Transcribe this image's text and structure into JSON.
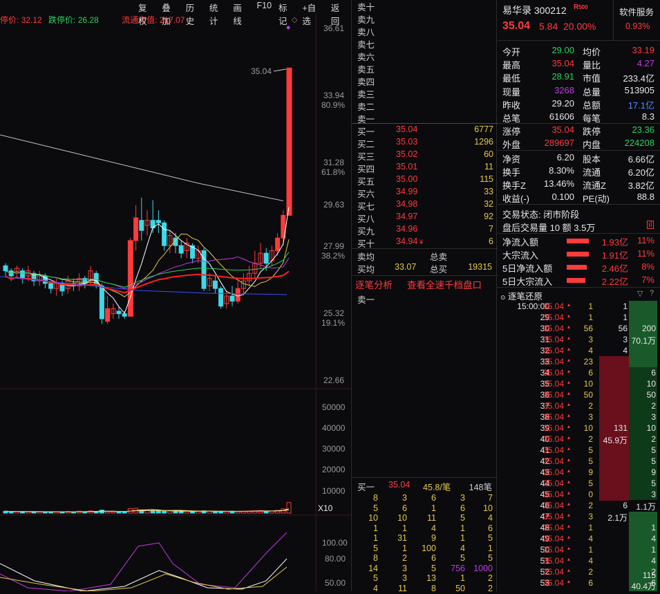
{
  "chart_header": {
    "limit_up": "停价: 32.12",
    "limit_down": "跌停价: 26.28",
    "float_cap": "流通市值: 217.07"
  },
  "toolbar": [
    "复权",
    "叠加",
    "历史",
    "统计",
    "画线",
    "F10",
    "标记",
    "+自选",
    "返回"
  ],
  "price_axis": [
    {
      "price": "36.61",
      "pct": ""
    },
    {
      "price": "33.94",
      "pct": "80.9%"
    },
    {
      "price": "31.28",
      "pct": "61.8%"
    },
    {
      "price": "29.63",
      "pct": ""
    },
    {
      "price": "27.99",
      "pct": "38.2%"
    },
    {
      "price": "25.32",
      "pct": "19.1%"
    },
    {
      "price": "22.66",
      "pct": ""
    }
  ],
  "high_marker": "35.04",
  "volume_axis": [
    "50000",
    "40000",
    "30000",
    "20000",
    "10000"
  ],
  "volume_unit": "X10",
  "indicator_axis": [
    "100.00",
    "80.00",
    "50.00"
  ],
  "candles": [
    {
      "o": 27.2,
      "c": 27.0,
      "h": 27.3,
      "l": 26.8
    },
    {
      "o": 27.0,
      "c": 26.8,
      "h": 27.1,
      "l": 26.6
    },
    {
      "o": 26.9,
      "c": 27.1,
      "h": 27.2,
      "l": 26.7
    },
    {
      "o": 27.0,
      "c": 26.7,
      "h": 27.1,
      "l": 26.5
    },
    {
      "o": 26.8,
      "c": 27.0,
      "h": 27.2,
      "l": 26.6
    },
    {
      "o": 26.9,
      "c": 26.6,
      "h": 27.0,
      "l": 26.4
    },
    {
      "o": 26.6,
      "c": 26.8,
      "h": 27.0,
      "l": 26.4
    },
    {
      "o": 26.8,
      "c": 26.5,
      "h": 26.9,
      "l": 26.3
    },
    {
      "o": 26.5,
      "c": 26.3,
      "h": 26.6,
      "l": 26.1
    },
    {
      "o": 26.3,
      "c": 26.5,
      "h": 26.7,
      "l": 26.0
    },
    {
      "o": 26.5,
      "c": 26.2,
      "h": 26.6,
      "l": 26.0
    },
    {
      "o": 26.3,
      "c": 26.6,
      "h": 26.8,
      "l": 26.1
    },
    {
      "o": 26.5,
      "c": 26.4,
      "h": 26.7,
      "l": 26.2
    },
    {
      "o": 26.4,
      "c": 26.7,
      "h": 26.9,
      "l": 26.2
    },
    {
      "o": 26.7,
      "c": 26.5,
      "h": 26.8,
      "l": 26.3
    },
    {
      "o": 26.6,
      "c": 27.0,
      "h": 27.2,
      "l": 26.4
    },
    {
      "o": 26.9,
      "c": 26.5,
      "h": 27.0,
      "l": 26.3
    },
    {
      "o": 26.4,
      "c": 25.1,
      "h": 26.5,
      "l": 24.9
    },
    {
      "o": 25.0,
      "c": 25.5,
      "h": 26.0,
      "l": 24.9
    },
    {
      "o": 25.3,
      "c": 25.5,
      "h": 25.7,
      "l": 25.1
    },
    {
      "o": 25.4,
      "c": 25.3,
      "h": 25.6,
      "l": 25.1
    },
    {
      "o": 25.3,
      "c": 25.2,
      "h": 25.4,
      "l": 25.1
    },
    {
      "o": 25.2,
      "c": 28.2,
      "h": 28.3,
      "l": 25.2
    },
    {
      "o": 28.2,
      "c": 29.1,
      "h": 29.6,
      "l": 27.8
    },
    {
      "o": 29.0,
      "c": 28.6,
      "h": 29.9,
      "l": 28.2
    },
    {
      "o": 28.8,
      "c": 29.0,
      "h": 29.4,
      "l": 28.4
    },
    {
      "o": 29.0,
      "c": 28.7,
      "h": 29.8,
      "l": 28.5
    },
    {
      "o": 29.0,
      "c": 28.9,
      "h": 29.4,
      "l": 28.5
    },
    {
      "o": 28.9,
      "c": 28.0,
      "h": 29.0,
      "l": 27.8
    },
    {
      "o": 28.0,
      "c": 28.4,
      "h": 28.6,
      "l": 27.7
    },
    {
      "o": 28.3,
      "c": 28.0,
      "h": 28.5,
      "l": 27.7
    },
    {
      "o": 28.0,
      "c": 27.7,
      "h": 28.2,
      "l": 27.5
    },
    {
      "o": 27.8,
      "c": 28.1,
      "h": 28.3,
      "l": 27.5
    },
    {
      "o": 28.0,
      "c": 27.5,
      "h": 28.1,
      "l": 27.3
    },
    {
      "o": 27.5,
      "c": 27.8,
      "h": 28.0,
      "l": 27.3
    },
    {
      "o": 27.8,
      "c": 26.3,
      "h": 27.9,
      "l": 26.2
    },
    {
      "o": 26.4,
      "c": 26.7,
      "h": 26.9,
      "l": 26.2
    },
    {
      "o": 26.6,
      "c": 26.3,
      "h": 26.8,
      "l": 26.1
    },
    {
      "o": 26.3,
      "c": 25.6,
      "h": 26.4,
      "l": 25.5
    },
    {
      "o": 25.7,
      "c": 26.0,
      "h": 26.2,
      "l": 25.5
    },
    {
      "o": 26.0,
      "c": 25.8,
      "h": 26.4,
      "l": 25.6
    },
    {
      "o": 25.8,
      "c": 26.3,
      "h": 26.6,
      "l": 25.7
    },
    {
      "o": 26.3,
      "c": 26.6,
      "h": 26.9,
      "l": 26.1
    },
    {
      "o": 26.6,
      "c": 26.9,
      "h": 27.2,
      "l": 26.4
    },
    {
      "o": 26.9,
      "c": 27.3,
      "h": 27.8,
      "l": 26.7
    },
    {
      "o": 27.3,
      "c": 27.7,
      "h": 28.1,
      "l": 27.1
    },
    {
      "o": 27.7,
      "c": 27.3,
      "h": 27.9,
      "l": 27.0
    },
    {
      "o": 27.4,
      "c": 27.8,
      "h": 28.0,
      "l": 27.2
    },
    {
      "o": 27.8,
      "c": 28.3,
      "h": 28.5,
      "l": 27.6
    },
    {
      "o": 28.3,
      "c": 29.2,
      "h": 29.4,
      "l": 28.0
    },
    {
      "o": 29.2,
      "c": 35.04,
      "h": 35.04,
      "l": 29.2
    }
  ],
  "volumes": [
    900,
    700,
    800,
    600,
    750,
    650,
    700,
    600,
    550,
    700,
    500,
    800,
    650,
    900,
    700,
    1000,
    800,
    1400,
    700,
    600,
    550,
    600,
    2200,
    2300,
    1500,
    1200,
    1100,
    1300,
    1000,
    1000,
    900,
    800,
    950,
    800,
    850,
    1100,
    950,
    800,
    700,
    750,
    900,
    850,
    900,
    1000,
    1100,
    1200,
    900,
    1000,
    1300,
    2000,
    5000
  ],
  "book": {
    "sells": [
      "卖十",
      "卖九",
      "卖八",
      "卖七",
      "卖六",
      "卖五",
      "卖四",
      "卖三",
      "卖二",
      "卖一"
    ],
    "buys": [
      {
        "label": "买一",
        "price": "35.04",
        "vol": "6777"
      },
      {
        "label": "买二",
        "price": "35.03",
        "vol": "1296"
      },
      {
        "label": "买三",
        "price": "35.02",
        "vol": "60"
      },
      {
        "label": "买四",
        "price": "35.01",
        "vol": "11"
      },
      {
        "label": "买五",
        "price": "35.00",
        "vol": "115"
      },
      {
        "label": "买六",
        "price": "34.99",
        "vol": "33"
      },
      {
        "label": "买七",
        "price": "34.98",
        "vol": "32"
      },
      {
        "label": "买八",
        "price": "34.97",
        "vol": "92"
      },
      {
        "label": "买九",
        "price": "34.96",
        "vol": "7"
      },
      {
        "label": "买十",
        "price": "34.94",
        "vol": "6"
      }
    ],
    "buy10_mark": "¥",
    "summary": {
      "sell_avg": "卖均",
      "total_sell": "总卖",
      "buy_avg": "买均",
      "buy_avg_val": "33.07",
      "total_buy": "总买",
      "total_buy_val": "19315"
    },
    "tabs": {
      "a": "逐笔分析",
      "b": "查看全速千档盘口"
    },
    "sell1_label": "卖一",
    "bid_bar": {
      "label": "买一",
      "price": "35.04",
      "per": "45.8/笔",
      "count": "148笔"
    },
    "queue": [
      [
        "8",
        "3",
        "6",
        "3",
        "7"
      ],
      [
        "5",
        "6",
        "1",
        "6",
        "10"
      ],
      [
        "10",
        "10",
        "11",
        "5",
        "4"
      ],
      [
        "1",
        "1",
        "4",
        "1",
        "6"
      ],
      [
        "1",
        "31",
        "9",
        "1",
        "5"
      ],
      [
        "5",
        "1",
        "100",
        "4",
        "1"
      ],
      [
        "8",
        "2",
        "6",
        "5",
        "5"
      ],
      [
        "14",
        "3",
        "5",
        "756",
        "1000"
      ],
      [
        "5",
        "3",
        "13",
        "1",
        "2"
      ],
      [
        "4",
        "11",
        "8",
        "50",
        "2"
      ]
    ]
  },
  "quote": {
    "name": "易华录 300212",
    "badge": "R",
    "badge_sub": "500",
    "service": "软件服务",
    "service_pct": "0.93%",
    "price": "35.04",
    "change": "5.84",
    "pct": "20.00%",
    "grid": [
      [
        "今开",
        "29.00",
        "均价",
        "33.19"
      ],
      [
        "最高",
        "35.04",
        "量比",
        "4.27"
      ],
      [
        "最低",
        "28.91",
        "市值",
        "233.4亿"
      ],
      [
        "现量",
        "3268",
        "总量",
        "513905"
      ],
      [
        "昨收",
        "29.20",
        "总额",
        "17.1亿"
      ],
      [
        "总笔",
        "61606",
        "每笔",
        "8.3"
      ]
    ],
    "grid2": [
      [
        "涨停",
        "35.04",
        "跌停",
        "23.36"
      ],
      [
        "外盘",
        "289697",
        "内盘",
        "224208"
      ]
    ],
    "grid3": [
      [
        "净资",
        "6.20",
        "股本",
        "6.66亿"
      ],
      [
        "换手",
        "8.30%",
        "流通",
        "6.20亿"
      ],
      [
        "换手Z",
        "13.46%",
        "流通Z",
        "3.82亿"
      ],
      [
        "收益(-)",
        "0.100",
        "PE(动)",
        "88.8"
      ]
    ],
    "status": "交易状态: 闭市阶段",
    "after": "盘后交易量 10 额 3.5万",
    "flows": [
      {
        "label": "净流入额",
        "val": "1.93亿",
        "pct": "11%",
        "fill": 0.9
      },
      {
        "label": "大宗流入",
        "val": "1.91亿",
        "pct": "11%",
        "fill": 0.9
      },
      {
        "label": "5日净流入额",
        "val": "2.46亿",
        "pct": "8%",
        "fill": 0.8
      },
      {
        "label": "5日大宗流入",
        "val": "2.22亿",
        "pct": "7%",
        "fill": 0.75
      }
    ],
    "ticks_title": "逐笔还原",
    "ticks": [
      {
        "t": "15:00:00",
        "p": "35.04",
        "v": "1",
        "o": "1",
        "r": "",
        "r2": ""
      },
      {
        "t": "29",
        "p": "35.04",
        "v": "1",
        "o": "1",
        "r": "",
        "r2": ""
      },
      {
        "t": "30",
        "p": "35.04",
        "v": "56",
        "o": "56",
        "r": "200",
        "r2": ""
      },
      {
        "t": "31",
        "p": "35.04",
        "v": "3",
        "o": "3",
        "r": "70.1万",
        "r2": ""
      },
      {
        "t": "32",
        "p": "35.04",
        "v": "4",
        "o": "4",
        "r": "",
        "r2": ""
      },
      {
        "t": "33",
        "p": "35.04",
        "v": "23",
        "o": "",
        "r": "",
        "r2": ""
      },
      {
        "t": "34",
        "p": "35.04",
        "v": "6",
        "o": "",
        "r": "6",
        "r2": ""
      },
      {
        "t": "35",
        "p": "35.04",
        "v": "10",
        "o": "",
        "r": "10",
        "r2": ""
      },
      {
        "t": "36",
        "p": "35.04",
        "v": "50",
        "o": "",
        "r": "50",
        "r2": ""
      },
      {
        "t": "37",
        "p": "35.04",
        "v": "2",
        "o": "",
        "r": "2",
        "r2": ""
      },
      {
        "t": "38",
        "p": "35.04",
        "v": "3",
        "o": "",
        "r": "3",
        "r2": ""
      },
      {
        "t": "39",
        "p": "35.04",
        "v": "10",
        "o": "131",
        "r": "10",
        "r2": ""
      },
      {
        "t": "40",
        "p": "35.04",
        "v": "2",
        "o": "45.9万",
        "r": "2",
        "r2": ""
      },
      {
        "t": "41",
        "p": "35.04",
        "v": "5",
        "o": "",
        "r": "5",
        "r2": ""
      },
      {
        "t": "42",
        "p": "35.04",
        "v": "5",
        "o": "",
        "r": "5",
        "r2": ""
      },
      {
        "t": "43",
        "p": "35.04",
        "v": "9",
        "o": "",
        "r": "9",
        "r2": ""
      },
      {
        "t": "44",
        "p": "35.04",
        "v": "5",
        "o": "",
        "r": "5",
        "r2": ""
      },
      {
        "t": "45",
        "p": "35.04",
        "v": "0",
        "o": "",
        "r": "3",
        "r2": ""
      },
      {
        "t": "46",
        "p": "35.04",
        "v": "2",
        "o": "6",
        "r": "1.1万",
        "r2": ""
      },
      {
        "t": "47",
        "p": "35.04",
        "v": "3",
        "o": "2.1万",
        "r": "",
        "r2": ""
      },
      {
        "t": "48",
        "p": "35.04",
        "v": "1",
        "o": "",
        "r": "1",
        "r2": ""
      },
      {
        "t": "49",
        "p": "35.04",
        "v": "4",
        "o": "",
        "r": "4",
        "r2": ""
      },
      {
        "t": "50",
        "p": "35.04",
        "v": "1",
        "o": "",
        "r": "1",
        "r2": ""
      },
      {
        "t": "51",
        "p": "35.04",
        "v": "4",
        "o": "",
        "r": "4",
        "r2": ""
      },
      {
        "t": "52",
        "p": "35.04",
        "v": "2",
        "o": "",
        "r": "2",
        "r2": ""
      },
      {
        "t": "53",
        "p": "35.04",
        "v": "6",
        "o": "",
        "r": "6",
        "r2": ""
      }
    ],
    "tick_blocks": {
      "b1a": "115",
      "b1b": "40.4万"
    }
  },
  "colors": {
    "up": "#ff3b3b",
    "down": "#3fd8e8",
    "panel": "#0b0b0e"
  }
}
